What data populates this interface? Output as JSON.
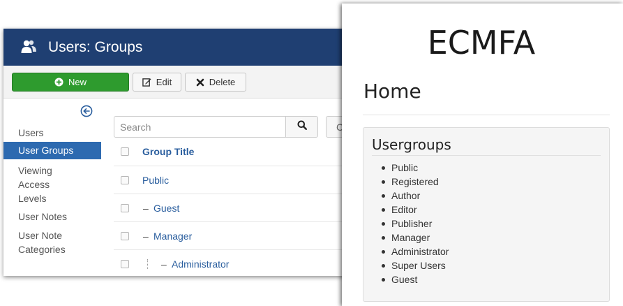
{
  "admin": {
    "title": "Users: Groups",
    "toolbar": {
      "new_label": "New",
      "edit_label": "Edit",
      "delete_label": "Delete"
    },
    "sidebar": {
      "items": [
        {
          "label": "Users",
          "active": false
        },
        {
          "label": "User Groups",
          "active": true
        },
        {
          "label": "Viewing\nAccess\nLevels",
          "active": false
        },
        {
          "label": "User Notes",
          "active": false
        },
        {
          "label": "User Note\nCategories",
          "active": false
        }
      ]
    },
    "search": {
      "placeholder": "Search",
      "clear_label_partial": "C"
    },
    "table": {
      "header": "Group Title",
      "rows": [
        {
          "prefix": "",
          "title": "Public"
        },
        {
          "prefix": "–",
          "title": "Guest"
        },
        {
          "prefix": "–",
          "title": "Manager"
        },
        {
          "prefix": "–",
          "title": "Administrator"
        }
      ]
    },
    "colors": {
      "titlebar": "#1f3f72",
      "new_button": "#2e9b2e",
      "active_item": "#2d6ab0",
      "link": "#2a5e9e"
    }
  },
  "site": {
    "brand": "ECMFA",
    "heading": "Home",
    "panel_title": "Usergroups",
    "groups": [
      "Public",
      "Registered",
      "Author",
      "Editor",
      "Publisher",
      "Manager",
      "Administrator",
      "Super Users",
      "Guest"
    ]
  }
}
